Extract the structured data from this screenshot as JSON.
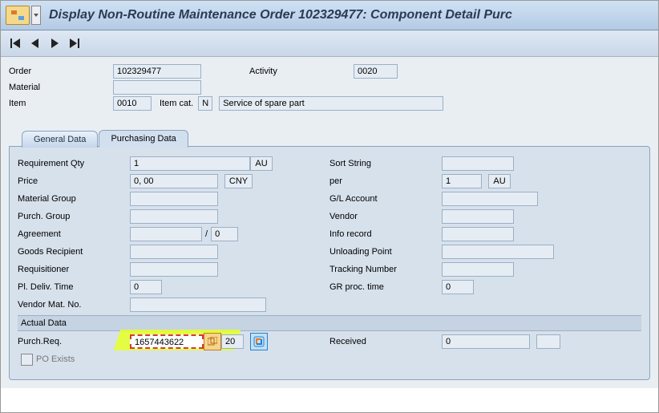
{
  "title": "Display Non-Routine Maintenance Order 102329477: Component Detail Purc",
  "nav": {
    "first": "|◀",
    "prev": "◀",
    "next": "▶",
    "last": "▶|"
  },
  "header": {
    "order_lbl": "Order",
    "order": "102329477",
    "activity_lbl": "Activity",
    "activity": "0020",
    "material_lbl": "Material",
    "material": "",
    "item_lbl": "Item",
    "item": "0010",
    "itemcat_lbl": "Item cat.",
    "itemcat": "N",
    "itemcat_desc": "Service of spare part"
  },
  "tabs": {
    "general": "General Data",
    "purchasing": "Purchasing Data"
  },
  "purch": {
    "reqqty_lbl": "Requirement Qty",
    "reqqty": "1",
    "reqqty_u": "AU",
    "price_lbl": "Price",
    "price": "0, 00",
    "price_u": "CNY",
    "matgrp_lbl": "Material Group",
    "matgrp": "",
    "pgrp_lbl": "Purch. Group",
    "pgrp": "",
    "agr_lbl": "Agreement",
    "agr": "",
    "agr2": "0",
    "goods_lbl": "Goods Recipient",
    "goods": "",
    "reqn_lbl": "Requisitioner",
    "reqn": "",
    "pldel_lbl": "Pl. Deliv. Time",
    "pldel": "0",
    "vendmat_lbl": "Vendor Mat. No.",
    "vendmat": "",
    "sort_lbl": "Sort String",
    "sort": "",
    "per_lbl": "per",
    "per": "1",
    "per_u": "AU",
    "gl_lbl": "G/L Account",
    "gl": "",
    "vendor_lbl": "Vendor",
    "vendor": "",
    "info_lbl": "Info record",
    "info": "",
    "unload_lbl": "Unloading Point",
    "unload": "",
    "track_lbl": "Tracking Number",
    "track": "",
    "grproc_lbl": "GR proc. time",
    "grproc": "0"
  },
  "actual": {
    "section": "Actual Data",
    "preq_lbl": "Purch.Req.",
    "preq": "1657443622",
    "preq_item": "20",
    "recv_lbl": "Received",
    "recv": "0",
    "poexists_lbl": "PO Exists"
  },
  "colors": {
    "highlight": "#e6ff2b",
    "accent_blue": "#3a76b9"
  }
}
